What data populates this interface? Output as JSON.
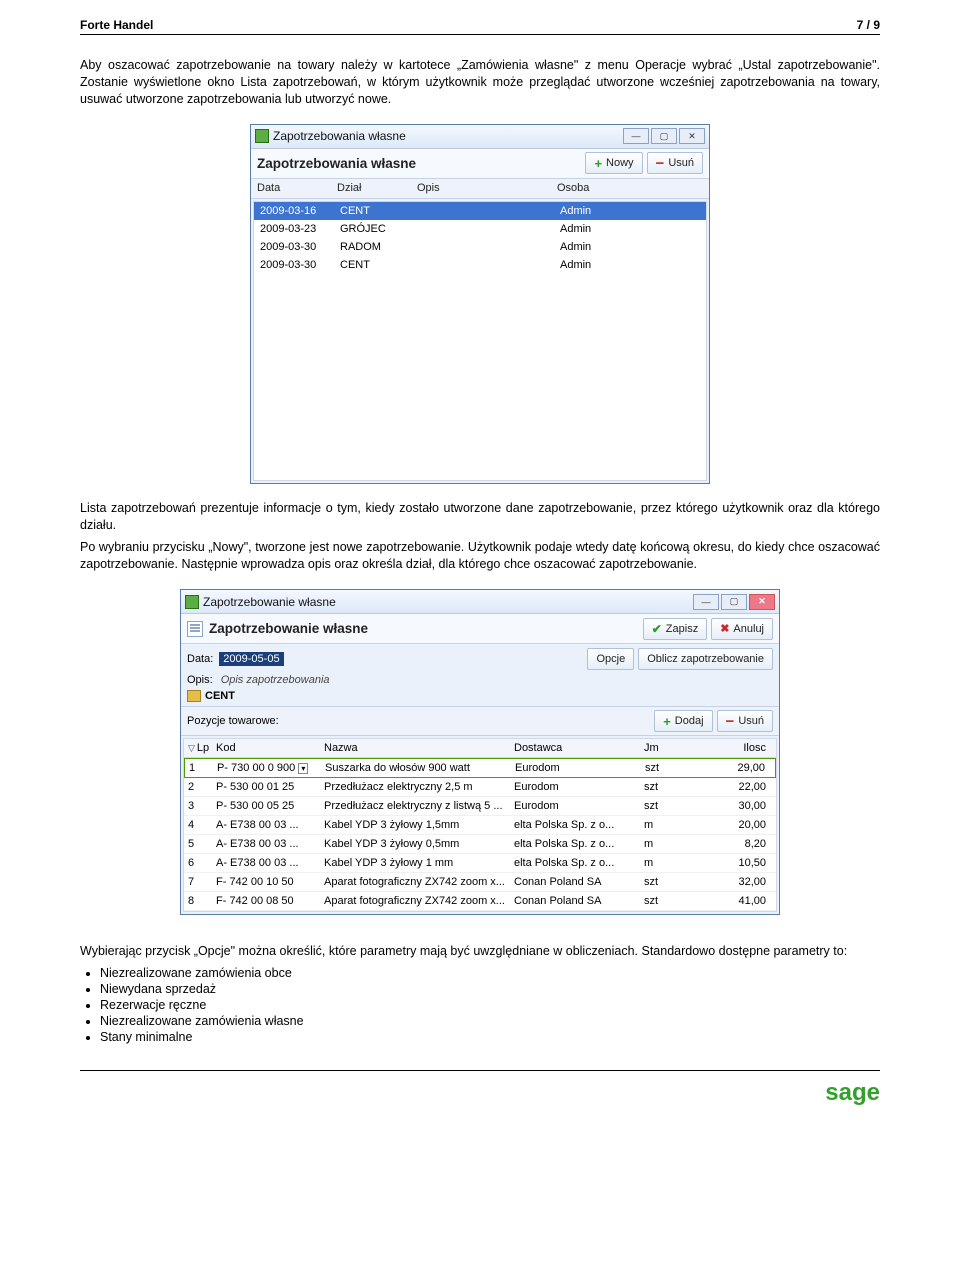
{
  "header": {
    "title": "Forte Handel",
    "page": "7 / 9"
  },
  "para1": "Aby oszacować zapotrzebowanie na towary należy w kartotece „Zamówienia własne\" z menu Operacje wybrać „Ustal zapotrzebowanie\". Zostanie wyświetlone okno Lista zapotrzebowań, w którym użytkownik może przeglądać utworzone wcześniej zapotrzebowania na towary, usuwać utworzone zapotrzebowania lub utworzyć nowe.",
  "win1": {
    "title": "Zapotrzebowania własne",
    "toolbar_title": "Zapotrzebowania własne",
    "btn_new": "Nowy",
    "btn_del": "Usuń",
    "cols": {
      "data": "Data",
      "dzial": "Dział",
      "opis": "Opis",
      "osoba": "Osoba"
    },
    "rows": [
      {
        "data": "2009-03-16",
        "dzial": "CENT",
        "opis": "",
        "osoba": "Admin",
        "sel": true
      },
      {
        "data": "2009-03-23",
        "dzial": "GRÓJEC",
        "opis": "",
        "osoba": "Admin"
      },
      {
        "data": "2009-03-30",
        "dzial": "RADOM",
        "opis": "",
        "osoba": "Admin"
      },
      {
        "data": "2009-03-30",
        "dzial": "CENT",
        "opis": "",
        "osoba": "Admin"
      }
    ]
  },
  "para2": "Lista zapotrzebowań prezentuje informacje o tym, kiedy zostało utworzone dane zapotrzebowanie, przez którego użytkownik oraz dla którego działu.",
  "para3": "Po wybraniu przycisku „Nowy\", tworzone jest nowe zapotrzebowanie. Użytkownik podaje wtedy datę końcową okresu, do kiedy chce oszacować zapotrzebowanie. Następnie wprowadza opis oraz określa dział, dla którego chce oszacować zapotrzebowanie.",
  "win2": {
    "title": "Zapotrzebowanie własne",
    "toolbar_title": "Zapotrzebowanie własne",
    "btn_save": "Zapisz",
    "btn_cancel": "Anuluj",
    "lbl_data": "Data:",
    "date_val": "2009-05-05",
    "btn_opcje": "Opcje",
    "btn_oblicz": "Oblicz zapotrzebowanie",
    "lbl_opis": "Opis:",
    "opis_val": "Opis zapotrzebowania",
    "cent": "CENT",
    "section": "Pozycje towarowe:",
    "btn_add": "Dodaj",
    "btn_del": "Usuń",
    "cols": {
      "lp": "Lp",
      "kod": "Kod",
      "nazwa": "Nazwa",
      "dost": "Dostawca",
      "jm": "Jm",
      "ilosc": "Ilosc"
    },
    "rows": [
      {
        "lp": "1",
        "kod": "P- 730 00 0 900",
        "nazwa": "Suszarka do włosów 900 watt",
        "dost": "Eurodom",
        "jm": "szt",
        "ilosc": "29,00",
        "sel": true
      },
      {
        "lp": "2",
        "kod": "P- 530 00 01 25",
        "nazwa": "Przedłużacz elektryczny 2,5 m",
        "dost": "Eurodom",
        "jm": "szt",
        "ilosc": "22,00"
      },
      {
        "lp": "3",
        "kod": "P- 530 00 05 25",
        "nazwa": "Przedłużacz elektryczny z listwą 5 ...",
        "dost": "Eurodom",
        "jm": "szt",
        "ilosc": "30,00"
      },
      {
        "lp": "4",
        "kod": "A- E738 00 03 ...",
        "nazwa": "Kabel YDP 3 żyłowy 1,5mm",
        "dost": "elta Polska Sp. z o...",
        "jm": "m",
        "ilosc": "20,00"
      },
      {
        "lp": "5",
        "kod": "A- E738 00 03 ...",
        "nazwa": "Kabel YDP 3 żyłowy 0,5mm",
        "dost": "elta Polska Sp. z o...",
        "jm": "m",
        "ilosc": "8,20"
      },
      {
        "lp": "6",
        "kod": "A- E738 00 03 ...",
        "nazwa": "Kabel YDP 3 żyłowy 1 mm",
        "dost": "elta Polska Sp. z o...",
        "jm": "m",
        "ilosc": "10,50"
      },
      {
        "lp": "7",
        "kod": "F- 742 00 10 50",
        "nazwa": "Aparat fotograficzny ZX742 zoom x...",
        "dost": "Conan Poland SA",
        "jm": "szt",
        "ilosc": "32,00"
      },
      {
        "lp": "8",
        "kod": "F- 742 00 08 50",
        "nazwa": "Aparat fotograficzny ZX742 zoom x...",
        "dost": "Conan Poland SA",
        "jm": "szt",
        "ilosc": "41,00"
      }
    ]
  },
  "para4": "Wybierając przycisk „Opcje\" można określić, które parametry mają być uwzględniane w obliczeniach. Standardowo dostępne parametry to:",
  "bullets": [
    "Niezrealizowane zamówienia obce",
    "Niewydana sprzedaż",
    "Rezerwacje ręczne",
    "Niezrealizowane zamówienia własne",
    "Stany minimalne"
  ],
  "footer": {
    "logo": "sage"
  }
}
